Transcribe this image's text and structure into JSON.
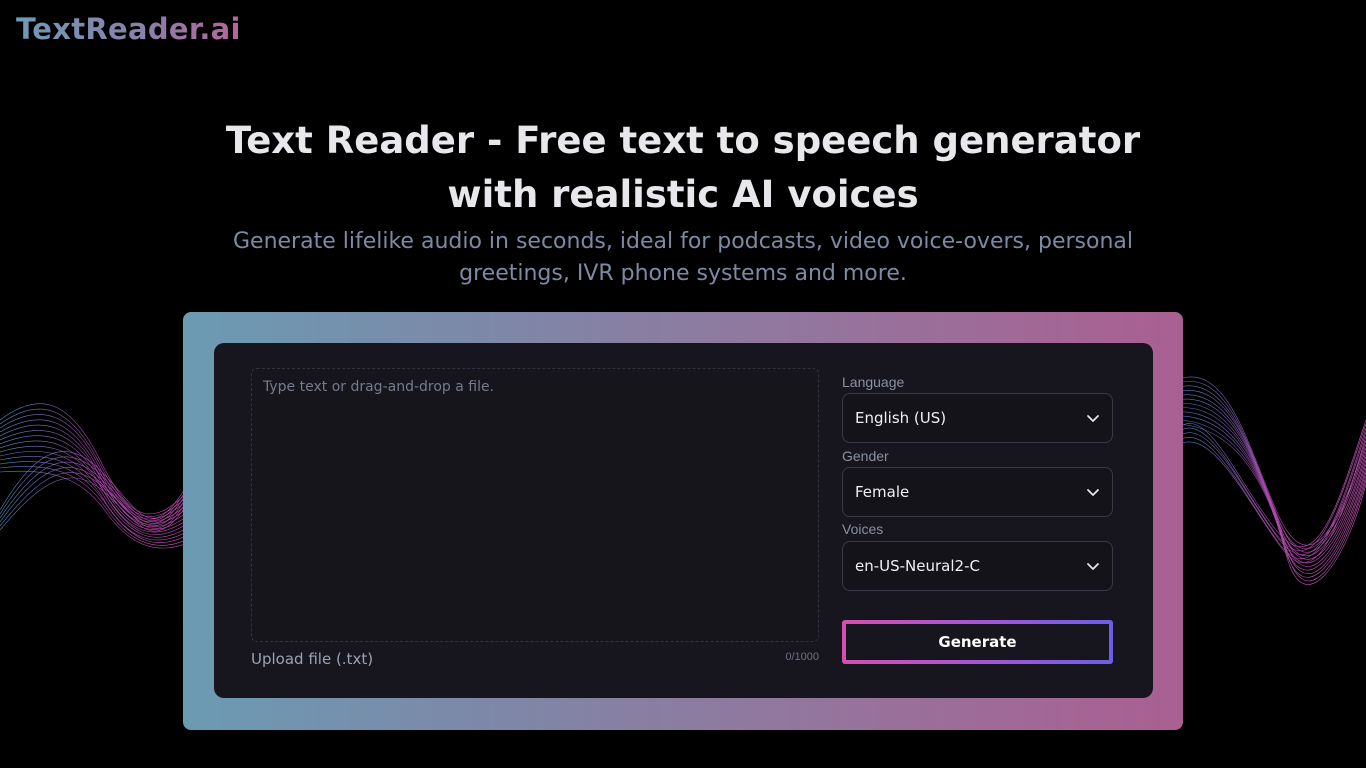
{
  "brand": {
    "name": "TextReader.ai"
  },
  "hero": {
    "title": "Text Reader - Free text to speech generator with realistic AI voices",
    "subtitle": "Generate lifelike audio in seconds, ideal for podcasts, video voice-overs, personal greetings, IVR phone systems and more."
  },
  "editor": {
    "placeholder": "Type text or drag-and-drop a file.",
    "upload_label": "Upload file (.txt)",
    "char_count": "0/1000"
  },
  "options": {
    "language": {
      "label": "Language",
      "value": "English (US)"
    },
    "gender": {
      "label": "Gender",
      "value": "Female"
    },
    "voices": {
      "label": "Voices",
      "value": "en-US-Neural2-C"
    }
  },
  "actions": {
    "generate_label": "Generate"
  },
  "icons": {
    "select_arrow": "chevron-down-icon"
  },
  "colors": {
    "background": "#000000",
    "card": "#17161e",
    "frame_gradient_start": "#6b9bb3",
    "frame_gradient_end": "#aa5f92",
    "button_gradient_start": "#d54fb0",
    "button_gradient_end": "#6c5fe6"
  }
}
